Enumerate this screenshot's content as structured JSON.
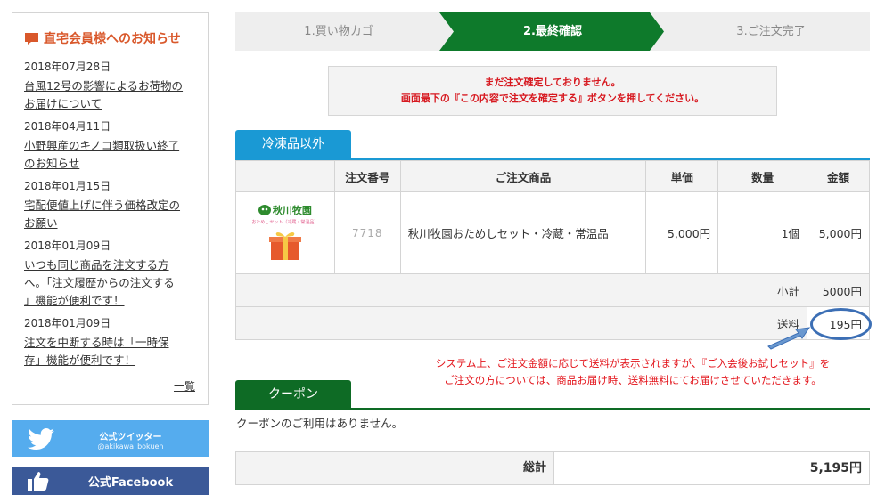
{
  "sidebar": {
    "news_title": "直宅会員様へのお知らせ",
    "news": [
      {
        "date": "2018年07月28日",
        "line1": "台風12号の影響によるお荷物の",
        "line2": "お届けについて"
      },
      {
        "date": "2018年04月11日",
        "line1": "小野興産のキノコ類取扱い終了",
        "line2": "のお知らせ"
      },
      {
        "date": "2018年01月15日",
        "line1": "宅配便値上げに伴う価格改定の",
        "line2": "お願い"
      },
      {
        "date": "2018年01月09日",
        "line1": "いつも同じ商品を注文する方",
        "line2": "へ。「注文履歴からの注文する",
        "line3": "」機能が便利です！"
      },
      {
        "date": "2018年01月09日",
        "line1": "注文を中断する時は「一時保",
        "line2": "存」機能が便利です！"
      }
    ],
    "more": "一覧",
    "twitter": {
      "label": "公式ツイッター",
      "handle": "@akikawa_bokuen"
    },
    "facebook": {
      "label": "公式Facebook"
    }
  },
  "steps": [
    "1.買い物カゴ",
    "2.最終確認",
    "3.ご注文完了"
  ],
  "warning": {
    "line1": "まだ注文確定しておりません。",
    "line2": "画面最下の『この内容で注文を確定する』ボタンを押してください。"
  },
  "section_tab": "冷凍品以外",
  "table": {
    "headers": [
      "",
      "注文番号",
      "ご注文商品",
      "単価",
      "数量",
      "金額"
    ],
    "row": {
      "logo": "秋川牧園",
      "logo_sub": "おためしセット（冷蔵・常温品）",
      "order_no": "7718",
      "product": "秋川牧園おためしセット・冷蔵・常温品",
      "unit_price": "5,000円",
      "qty": "1個",
      "amount": "5,000円"
    },
    "subtotal_label": "小計",
    "subtotal": "5000円",
    "shipping_label": "送料",
    "shipping": "195円"
  },
  "note": {
    "line1": "システム上、ご注文金額に応じて送料が表示されますが、『ご入会後お試しセット』を",
    "line2": "ご注文の方については、商品お届け時、送料無料にてお届けさせていただきます。"
  },
  "coupon": {
    "tab": "クーポン",
    "message": "クーポンのご利用はありません。"
  },
  "total": {
    "label": "総計",
    "value": "5,195円"
  },
  "colors": {
    "accent_blue": "#1a99d4",
    "accent_green": "#0e6b25",
    "step_active": "#0e7a2b",
    "warning_red": "#d71920",
    "note_red": "#e3141b",
    "news_orange": "#d9582b",
    "twitter": "#55acee",
    "facebook": "#3b5998"
  }
}
